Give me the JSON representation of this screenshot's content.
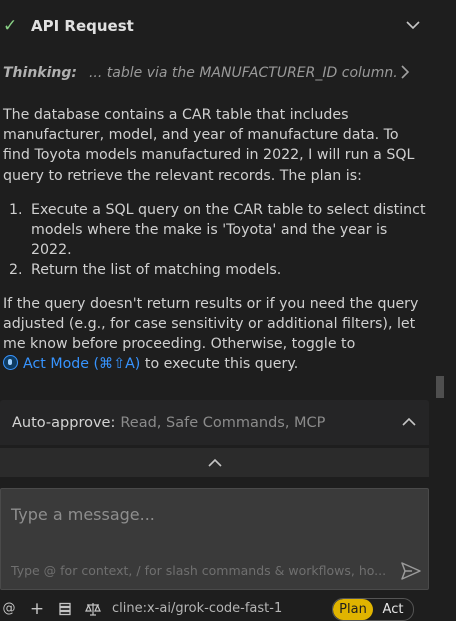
{
  "api_request": {
    "check": "✓",
    "title": "API Request"
  },
  "thinking": {
    "label": "Thinking:",
    "text": "... table via the MANUFACTURER_ID column."
  },
  "message": {
    "paragraph1": "The database contains a CAR table that includes manufacturer, model, and year of manufacture data. To find Toyota models manufactured in 2022, I will run a SQL query to retrieve the relevant records. The plan is:",
    "steps": [
      "Execute a SQL query on the CAR table to select distinct models where the make is 'Toyota' and the year is 2022.",
      "Return the list of matching models."
    ],
    "paragraph2": "If the query doesn't return results or if you need the query adjusted (e.g., for case sensitivity or additional filters), let me know before proceeding. Otherwise, toggle to",
    "act_mode_link": "Act Mode (⌘⇧A)",
    "paragraph2_tail": "to execute this query."
  },
  "auto_approve": {
    "label": "Auto-approve:",
    "value": "Read, Safe Commands, MCP"
  },
  "input": {
    "placeholder": "Type a message...",
    "hint": "Type @ for context, / for slash commands & workflows, ho..."
  },
  "toolbar": {
    "at": "@",
    "plus": "+",
    "model": "cline:x-ai/grok-code-fast-1",
    "plan": "Plan",
    "act": "Act"
  },
  "colors": {
    "accent": "#3794ff",
    "plan_active": "#e0b400",
    "success": "#89d185"
  }
}
